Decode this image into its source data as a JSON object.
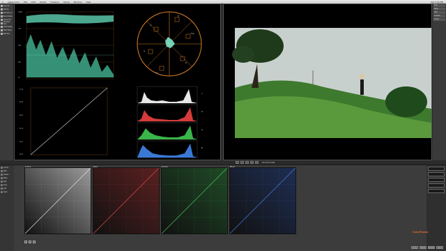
{
  "menubar": {
    "app_name": "Apple Color",
    "items": [
      "File",
      "Edit",
      "Grade",
      "Timeline",
      "Setup",
      "Window",
      "Help"
    ],
    "clock": "Sat 3:42 PM"
  },
  "left_tools": [
    "Layout",
    "Setup",
    "Primary In",
    "Secondary",
    "Color FX",
    "Primary Out",
    "Geometry",
    "Still Store",
    "Render"
  ],
  "scopes": {
    "waveform_ticks": [
      "100",
      "75",
      "50",
      "25",
      "0"
    ],
    "vectorscope_labels": [
      "R",
      "Mg",
      "B",
      "Cy",
      "G",
      "Yl"
    ],
    "curve_ticks": [
      "1.0",
      "0.8",
      "0.6",
      "0.4",
      "0.2",
      "0.0"
    ],
    "histogram_labels": [
      "Y",
      "R",
      "G",
      "B"
    ]
  },
  "viewer_tools": [
    "Full",
    "Split",
    "Still",
    "Guides",
    "Zoom"
  ],
  "viewer_bar": {
    "buttons": [
      "prev",
      "play",
      "next",
      "loop",
      "mark"
    ],
    "timecode": "00:00:12:08"
  },
  "bottom_tools": [
    "Luma",
    "Red",
    "Green",
    "Blue",
    "Sat",
    "Hue",
    "Lift",
    "Gain"
  ],
  "curves": [
    {
      "label": "Luma",
      "tint": "#9a9a9a"
    },
    {
      "label": "Red",
      "tint": "#c94a4a"
    },
    {
      "label": "Green",
      "tint": "#4aa05a"
    },
    {
      "label": "Blue",
      "tint": "#4a6ab8"
    }
  ],
  "right_panel": [
    "Lift",
    "Gamma",
    "Gain",
    "Sat",
    "Reset"
  ],
  "bottom_buttons": [
    "Copy",
    "Paste",
    "Reset",
    "Save"
  ],
  "brand": "ColorFrame"
}
